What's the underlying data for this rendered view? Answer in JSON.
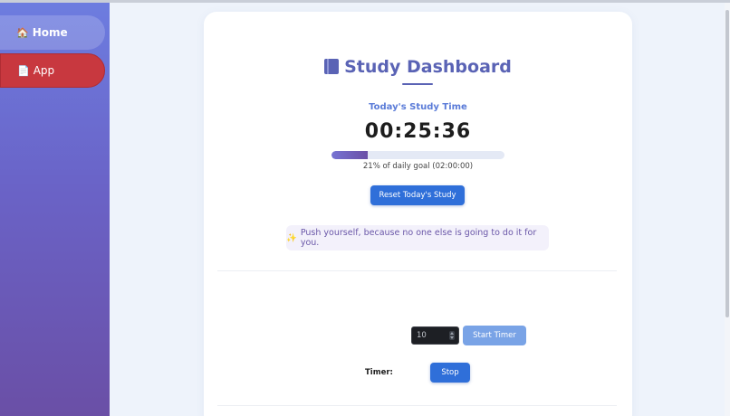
{
  "sidebar": {
    "items": [
      {
        "icon": "home-icon",
        "glyph": "🏠",
        "label": "Home"
      },
      {
        "icon": "page-icon",
        "glyph": "📄",
        "label": "App"
      }
    ]
  },
  "dashboard": {
    "title": "Study Dashboard",
    "today_label": "Today's Study Time",
    "elapsed": "00:25:36",
    "progress_fraction": 0.21,
    "goal_text": "21% of daily goal (02:00:00)",
    "reset_label": "Reset Today's Study",
    "quote": "Push yourself, because no one else is going to do it for you."
  },
  "timer": {
    "minutes_value": "10",
    "start_label": "Start Timer",
    "timer_label": "Timer:",
    "stop_label": "Stop"
  },
  "colors": {
    "accent": "#5a63b5",
    "button": "#2f6fd9",
    "active_nav": "#c8383f"
  }
}
